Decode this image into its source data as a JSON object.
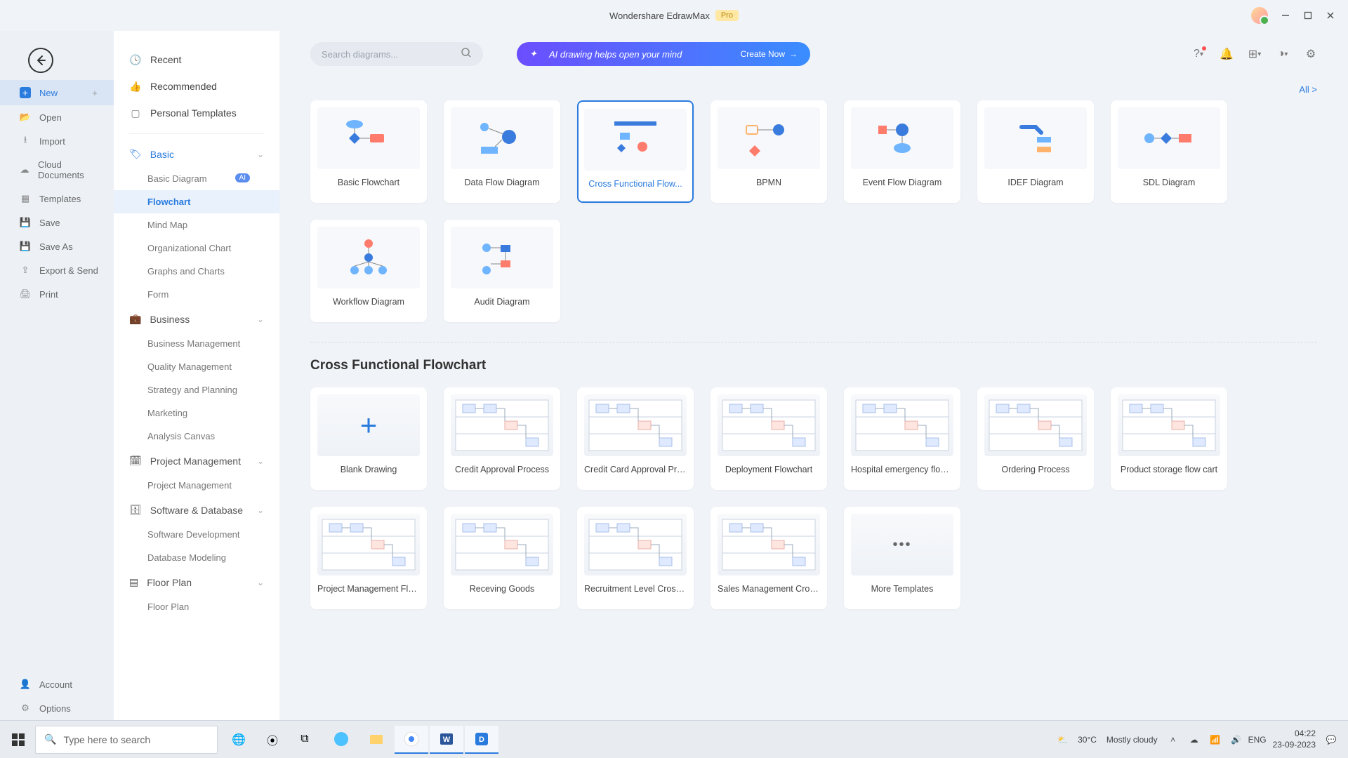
{
  "titlebar": {
    "app_name": "Wondershare EdrawMax",
    "pro": "Pro"
  },
  "leftnav": {
    "new": "New",
    "open": "Open",
    "import": "Import",
    "cloud": "Cloud Documents",
    "templates": "Templates",
    "save": "Save",
    "saveas": "Save As",
    "export": "Export & Send",
    "print": "Print",
    "account": "Account",
    "options": "Options"
  },
  "catnav": {
    "recent": "Recent",
    "recommended": "Recommended",
    "personal": "Personal Templates",
    "basic": {
      "title": "Basic",
      "items": [
        "Basic Diagram",
        "Flowchart",
        "Mind Map",
        "Organizational Chart",
        "Graphs and Charts",
        "Form"
      ],
      "ai_badge": "AI"
    },
    "business": {
      "title": "Business",
      "items": [
        "Business Management",
        "Quality Management",
        "Strategy and Planning",
        "Marketing",
        "Analysis Canvas"
      ]
    },
    "pm": {
      "title": "Project Management",
      "items": [
        "Project Management"
      ]
    },
    "sw": {
      "title": "Software & Database",
      "items": [
        "Software Development",
        "Database Modeling"
      ]
    },
    "floor": {
      "title": "Floor Plan",
      "items": [
        "Floor Plan"
      ]
    }
  },
  "search": {
    "placeholder": "Search diagrams..."
  },
  "ai_banner": {
    "text": "AI drawing helps open your mind",
    "cta": "Create Now"
  },
  "all_link": "All  >",
  "types": [
    {
      "label": "Basic Flowchart"
    },
    {
      "label": "Data Flow Diagram"
    },
    {
      "label": "Cross Functional Flow...",
      "selected": true
    },
    {
      "label": "BPMN"
    },
    {
      "label": "Event Flow Diagram"
    },
    {
      "label": "IDEF Diagram"
    },
    {
      "label": "SDL Diagram"
    },
    {
      "label": "Workflow Diagram"
    },
    {
      "label": "Audit Diagram"
    }
  ],
  "section_title": "Cross Functional Flowchart",
  "templates": [
    {
      "label": "Blank Drawing",
      "blank": true
    },
    {
      "label": "Credit Approval Process"
    },
    {
      "label": "Credit Card Approval Proc..."
    },
    {
      "label": "Deployment Flowchart"
    },
    {
      "label": "Hospital emergency flow c..."
    },
    {
      "label": "Ordering Process"
    },
    {
      "label": "Product storage flow cart"
    },
    {
      "label": "Project Management Flow..."
    },
    {
      "label": "Receving Goods"
    },
    {
      "label": "Recruitment Level Cross F..."
    },
    {
      "label": "Sales Management Crossf..."
    },
    {
      "label": "More Templates",
      "more": true
    }
  ],
  "taskbar": {
    "search_placeholder": "Type here to search",
    "weather_temp": "30°C",
    "weather_desc": "Mostly cloudy",
    "time": "04:22",
    "date": "23-09-2023"
  }
}
